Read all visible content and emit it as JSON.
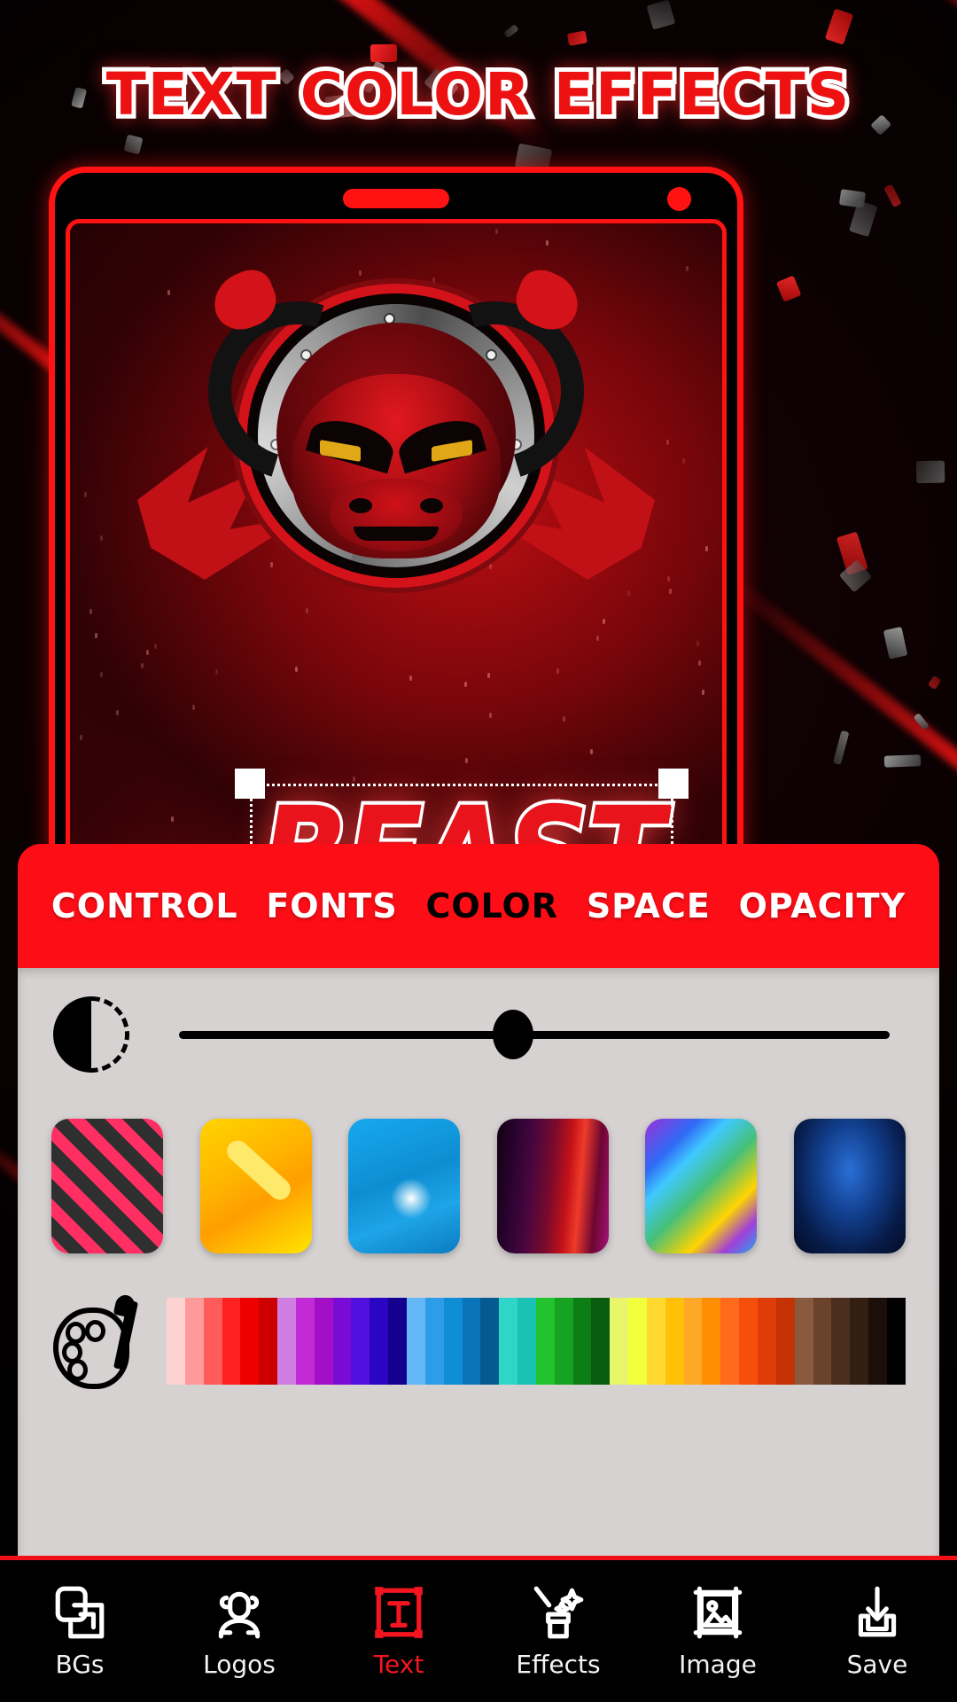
{
  "promo": {
    "headline": "TEXT COLOR EFFECTS"
  },
  "phone": {
    "notch_speaker": "speaker-bar",
    "camera": "front-camera-dot"
  },
  "canvas": {
    "mascot_name": "bull-mascot-logo",
    "selected_text": "BEAST",
    "selection": {
      "handles": [
        "top-left",
        "top-right",
        "bottom-left",
        "bottom-right"
      ]
    }
  },
  "tabs": {
    "items": [
      {
        "label": "CONTROL",
        "active": false
      },
      {
        "label": "FONTS",
        "active": false
      },
      {
        "label": "COLOR",
        "active": true
      },
      {
        "label": "SPACE",
        "active": false
      },
      {
        "label": "OPACITY",
        "active": false
      }
    ]
  },
  "controls": {
    "slider": {
      "icon": "contrast-icon",
      "value_percent": 47,
      "min": 0,
      "max": 100
    },
    "textures": {
      "icon": "texture-swatches",
      "items": [
        {
          "name": "pink-black-chevron",
          "colors": [
            "#ff2e63",
            "#2f2f2f"
          ]
        },
        {
          "name": "yellow-abstract",
          "colors": [
            "#ffd400",
            "#ff9e00"
          ]
        },
        {
          "name": "blue-diamond",
          "colors": [
            "#17a8ee",
            "#0b7cc0"
          ]
        },
        {
          "name": "purple-red-smoke",
          "colors": [
            "#45063f",
            "#ef3b2a"
          ]
        },
        {
          "name": "multicolor-geometric",
          "colors": [
            "#9b30d9",
            "#3fc9ff",
            "#ffd400"
          ]
        },
        {
          "name": "navy-glow",
          "colors": [
            "#2a6fd6",
            "#030c26"
          ]
        }
      ]
    },
    "palette": {
      "icon": "palette-brush-icon",
      "colors": [
        "#ffd2d2",
        "#ff9a9a",
        "#ff5b5b",
        "#ff2020",
        "#ee0000",
        "#cc0000",
        "#cf7de0",
        "#c22ad6",
        "#a30fc6",
        "#7a0ad6",
        "#5110e0",
        "#2a05c4",
        "#13008f",
        "#63b8f5",
        "#2e9de8",
        "#0f8ed6",
        "#0a74b8",
        "#065a92",
        "#2ed6c8",
        "#19c2b4",
        "#22c32e",
        "#17a322",
        "#0d7d16",
        "#0a5c10",
        "#e8f56b",
        "#f2ff3d",
        "#ffd92e",
        "#ffc107",
        "#ffa726",
        "#ff8f00",
        "#ff6b1a",
        "#f74e0c",
        "#e03c07",
        "#c43205",
        "#8a5a3f",
        "#6b422c",
        "#4c2e1e",
        "#331e13",
        "#1a0f09",
        "#000000"
      ]
    }
  },
  "bottom_nav": {
    "items": [
      {
        "label": "BGs",
        "icon": "layers-icon",
        "active": false
      },
      {
        "label": "Logos",
        "icon": "person-icon",
        "active": false
      },
      {
        "label": "Text",
        "icon": "text-box-icon",
        "active": true
      },
      {
        "label": "Effects",
        "icon": "magic-icon",
        "active": false
      },
      {
        "label": "Image",
        "icon": "picture-icon",
        "active": false
      },
      {
        "label": "Save",
        "icon": "download-icon",
        "active": false
      }
    ]
  },
  "theme": {
    "accent_red": "#fd0d16",
    "panel_grey": "#d6d2d2",
    "nav_black": "#000000",
    "text_white": "#ffffff"
  }
}
